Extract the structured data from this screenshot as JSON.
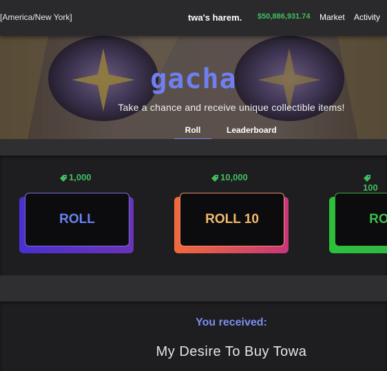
{
  "header": {
    "timezone": "[America/New York]",
    "site_name": "twa's harem.",
    "balance": "$50,886,931.74",
    "nav": {
      "market": "Market",
      "activity": "Activity"
    }
  },
  "hero": {
    "title": "gacha",
    "subtitle": "Take a chance and receive unique collectible items!",
    "tabs": {
      "roll": "Roll",
      "leaderboard": "Leaderboard"
    },
    "active_tab": "Roll"
  },
  "rolls": [
    {
      "price": "1,000",
      "label": "ROLL"
    },
    {
      "price": "10,000",
      "label": "ROLL 10"
    },
    {
      "price": "100",
      "label": "ROLL"
    }
  ],
  "result": {
    "heading": "You received:",
    "item": "My Desire To Buy Towa"
  },
  "colors": {
    "accent_blue": "#6f7ff2",
    "money_green": "#3fbf5f"
  },
  "icons": {
    "price_tag": "tag-icon"
  }
}
